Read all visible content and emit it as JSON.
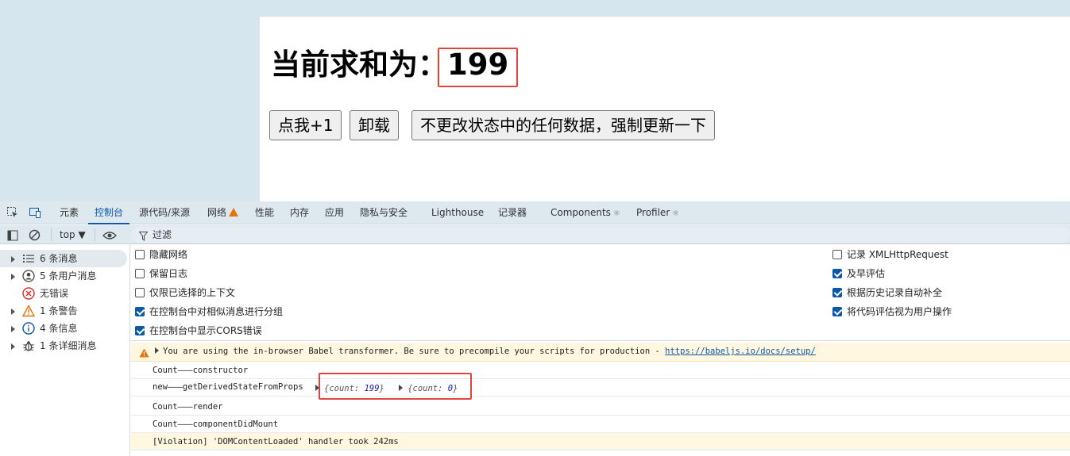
{
  "page": {
    "heading_label": "当前求和为：",
    "count": "199",
    "buttons": {
      "plus": "点我+1",
      "unmount": "卸载",
      "force_update": "不更改状态中的任何数据，强制更新一下"
    }
  },
  "devtools": {
    "tabs": [
      "元素",
      "控制台",
      "源代码/来源",
      "网络",
      "性能",
      "内存",
      "应用",
      "隐私与安全",
      "Lighthouse",
      "记录器",
      "Components",
      "Profiler"
    ],
    "active_tab": "控制台",
    "toolbar": {
      "context": "top",
      "filter_label": "过滤"
    },
    "sidebar": [
      {
        "label": "6 条消息",
        "icon": "list-icon"
      },
      {
        "label": "5 条用户消息",
        "icon": "user-icon"
      },
      {
        "label": "无错误",
        "icon": "error-icon"
      },
      {
        "label": "1 条警告",
        "icon": "warning-icon"
      },
      {
        "label": "4 条信息",
        "icon": "info-icon"
      },
      {
        "label": "1 条详细消息",
        "icon": "bug-icon"
      }
    ],
    "settings_left": [
      {
        "label": "隐藏网络",
        "checked": false
      },
      {
        "label": "保留日志",
        "checked": false
      },
      {
        "label": "仅限已选择的上下文",
        "checked": false
      },
      {
        "label": "在控制台中对相似消息进行分组",
        "checked": true
      },
      {
        "label": "在控制台中显示CORS错误",
        "checked": true
      }
    ],
    "settings_right": [
      {
        "label": "记录 XMLHttpRequest",
        "checked": false
      },
      {
        "label": "及早评估",
        "checked": true
      },
      {
        "label": "根据历史记录自动补全",
        "checked": true
      },
      {
        "label": "将代码评估视为用户操作",
        "checked": true
      }
    ],
    "console": {
      "warning_text": "You are using the in-browser Babel transformer. Be sure to precompile your scripts for production - ",
      "warning_link": "https://babeljs.io/docs/setup/",
      "log1": "Count———constructor",
      "log2_prefix": "new———getDerivedStateFromProps",
      "log2_obj1_key": "{count: ",
      "log2_obj1_val": "199",
      "log2_obj2_key": "{count: ",
      "log2_obj2_val": "0",
      "log3": "Count———render",
      "log4": "Count———componentDidMount",
      "violation": "[Violation] 'DOMContentLoaded' handler took 242ms"
    }
  },
  "colors": {
    "accent": "#0b57a8",
    "highlight_box": "#e0443c",
    "warning": "#e8710a"
  }
}
